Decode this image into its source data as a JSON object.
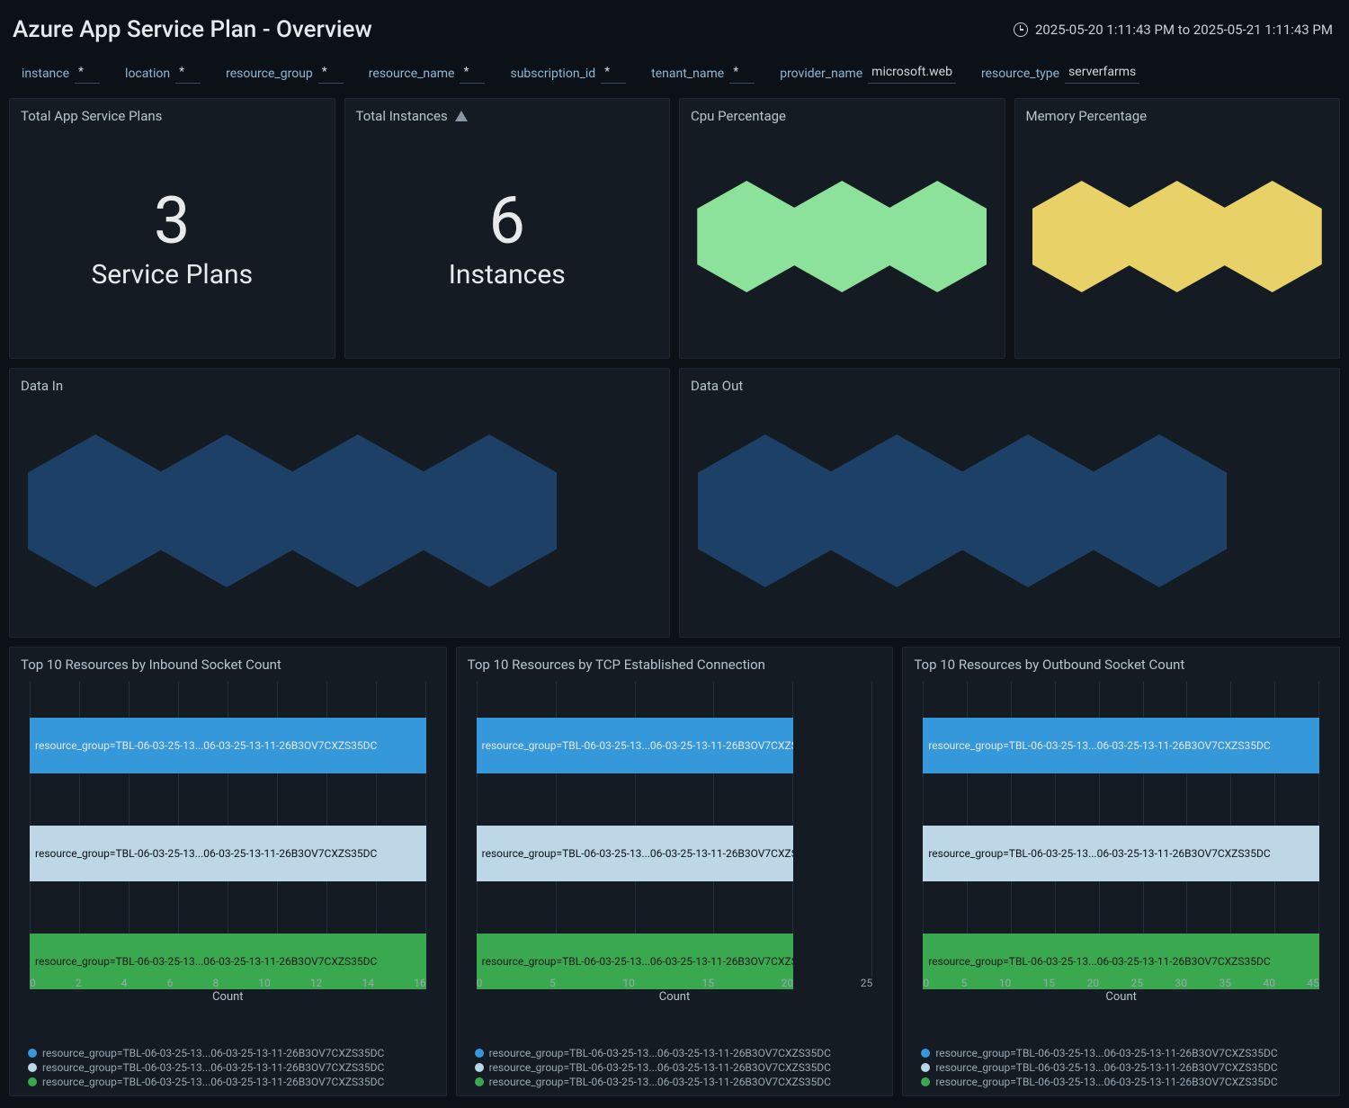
{
  "header": {
    "title": "Azure App Service Plan - Overview",
    "time_range": "2025-05-20 1:11:43 PM to 2025-05-21 1:11:43 PM"
  },
  "filters": [
    {
      "label": "instance",
      "value": "*"
    },
    {
      "label": "location",
      "value": "*"
    },
    {
      "label": "resource_group",
      "value": "*"
    },
    {
      "label": "resource_name",
      "value": "*"
    },
    {
      "label": "subscription_id",
      "value": "*"
    },
    {
      "label": "tenant_name",
      "value": "*"
    },
    {
      "label": "provider_name",
      "value": "microsoft.web"
    },
    {
      "label": "resource_type",
      "value": "serverfarms"
    }
  ],
  "panels": {
    "total_plans": {
      "title": "Total App Service Plans",
      "value": "3",
      "label": "Service Plans"
    },
    "total_instances": {
      "title": "Total Instances",
      "value": "6",
      "label": "Instances"
    },
    "cpu": {
      "title": "Cpu Percentage"
    },
    "memory": {
      "title": "Memory Percentage"
    },
    "data_in": {
      "title": "Data In"
    },
    "data_out": {
      "title": "Data Out"
    },
    "inbound": {
      "title": "Top 10 Resources by Inbound Socket Count",
      "xlabel": "Count"
    },
    "tcp": {
      "title": "Top 10 Resources by TCP Established Connection",
      "xlabel": "Count"
    },
    "outbound": {
      "title": "Top 10 Resources by Outbound Socket Count",
      "xlabel": "Count"
    }
  },
  "chart_data": [
    {
      "panel": "inbound",
      "type": "bar",
      "orientation": "horizontal",
      "xlabel": "Count",
      "xlim": [
        0,
        16
      ],
      "ticks": [
        "0",
        "2",
        "4",
        "6",
        "8",
        "10",
        "12",
        "14",
        "16"
      ],
      "series": [
        {
          "name": "resource_group=TBL-06-03-25-13...06-03-25-13-11-26B3OV7CXZS35DC",
          "value": 16,
          "color": "#3498db"
        },
        {
          "name": "resource_group=TBL-06-03-25-13...06-03-25-13-11-26B3OV7CXZS35DC",
          "value": 16,
          "color": "#bdd7e7"
        },
        {
          "name": "resource_group=TBL-06-03-25-13...06-03-25-13-11-26B3OV7CXZS35DC",
          "value": 16,
          "color": "#3aa84f"
        }
      ]
    },
    {
      "panel": "tcp",
      "type": "bar",
      "orientation": "horizontal",
      "xlabel": "Count",
      "xlim": [
        0,
        25
      ],
      "ticks": [
        "0",
        "5",
        "10",
        "15",
        "20",
        "25"
      ],
      "series": [
        {
          "name": "resource_group=TBL-06-03-25-13...06-03-25-13-11-26B3OV7CXZS35DC",
          "value": 20,
          "color": "#3498db"
        },
        {
          "name": "resource_group=TBL-06-03-25-13...06-03-25-13-11-26B3OV7CXZS35DC",
          "value": 20,
          "color": "#bdd7e7"
        },
        {
          "name": "resource_group=TBL-06-03-25-13...06-03-25-13-11-26B3OV7CXZS35DC",
          "value": 20,
          "color": "#3aa84f"
        }
      ]
    },
    {
      "panel": "outbound",
      "type": "bar",
      "orientation": "horizontal",
      "xlabel": "Count",
      "xlim": [
        0,
        45
      ],
      "ticks": [
        "0",
        "5",
        "10",
        "15",
        "20",
        "25",
        "30",
        "35",
        "40",
        "45"
      ],
      "series": [
        {
          "name": "resource_group=TBL-06-03-25-13...06-03-25-13-11-26B3OV7CXZS35DC",
          "value": 45,
          "color": "#3498db"
        },
        {
          "name": "resource_group=TBL-06-03-25-13...06-03-25-13-11-26B3OV7CXZS35DC",
          "value": 45,
          "color": "#bdd7e7"
        },
        {
          "name": "resource_group=TBL-06-03-25-13...06-03-25-13-11-26B3OV7CXZS35DC",
          "value": 45,
          "color": "#3aa84f"
        }
      ]
    }
  ],
  "legend_label": "resource_group=TBL-06-03-25-13...06-03-25-13-11-26B3OV7CXZS35DC"
}
